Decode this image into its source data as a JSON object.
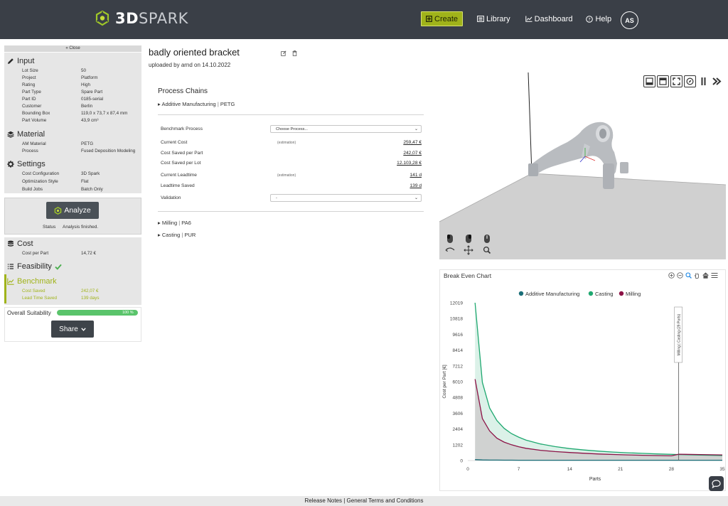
{
  "header": {
    "logo": {
      "brand_a": "3D",
      "brand_b": "SPARK"
    },
    "nav": {
      "create": "Create",
      "library": "Library",
      "dashboard": "Dashboard",
      "help": "Help"
    },
    "avatar": "AS"
  },
  "sidebar": {
    "close": "Close",
    "input": {
      "title": "Input",
      "rows": [
        {
          "label": "Lot Size",
          "value": "50"
        },
        {
          "label": "Project",
          "value": "Platform"
        },
        {
          "label": "Rating",
          "value": "High"
        },
        {
          "label": "Part Type",
          "value": "Spare Part"
        },
        {
          "label": "Part ID",
          "value": "0185-serial"
        },
        {
          "label": "Customer",
          "value": "Berlin"
        },
        {
          "label": "Bounding Box",
          "value": "119,0 x 73,7 x 87,4  mm"
        },
        {
          "label": "Part Volume",
          "value": "43,9 cm³"
        }
      ]
    },
    "material": {
      "title": "Material",
      "rows": [
        {
          "label": "AM Material",
          "value": "PETG"
        },
        {
          "label": "Process",
          "value": "Fused Deposition Modeling"
        }
      ]
    },
    "settings": {
      "title": "Settings",
      "rows": [
        {
          "label": "Cost Configuration",
          "value": "3D Spark"
        },
        {
          "label": "Optimization Style",
          "value": "Flat"
        },
        {
          "label": "Build Jobs",
          "value": "Batch Only"
        }
      ]
    },
    "analyze": {
      "button": "Analyze",
      "status_label": "Status",
      "status_value": "Analysis finished."
    },
    "cost": {
      "title": "Cost",
      "rows": [
        {
          "label": "Cost per Part",
          "value": "14,72 €"
        }
      ]
    },
    "feasibility": {
      "title": "Feasibility"
    },
    "benchmark": {
      "title": "Benchmark",
      "rows": [
        {
          "label": "Cost Saved",
          "value": "242,07 €"
        },
        {
          "label": "Lead Time Saved",
          "value": "139 days"
        }
      ]
    },
    "suitability": {
      "label": "Overall Suitability",
      "percent_text": "100 %",
      "value": 1.0
    },
    "share": "Share"
  },
  "main": {
    "title": "badly oriented bracket",
    "subtitle": "uploaded by arnd on 14.10.2022",
    "process_chains_title": "Process Chains",
    "chains": [
      {
        "name": "Additive Manufacturing",
        "material": "PETG"
      },
      {
        "name": "Milling",
        "material": "PA6"
      },
      {
        "name": "Casting",
        "material": "PUR"
      }
    ],
    "benchmark": {
      "process_label": "Benchmark Process",
      "process_select": "Choose Process...",
      "rows": [
        {
          "label": "Current Cost",
          "note": "(estimation)",
          "value": "259,47 €"
        },
        {
          "label": "Cost Saved per Part",
          "note": "",
          "value": "242,07 €"
        },
        {
          "label": "Cost Saved per Lot",
          "note": "",
          "value": "12.103,28 €"
        },
        {
          "label": "Current Leadtime",
          "note": "(estimation)",
          "value": "141 d"
        },
        {
          "label": "Leadtime Saved",
          "note": "",
          "value": "139 d"
        }
      ],
      "validation_label": "Validation",
      "validation_select": "-"
    }
  },
  "chart": {
    "title": "Break Even Chart"
  },
  "chart_data": {
    "type": "area",
    "title": "",
    "xlabel": "Parts",
    "ylabel": "Cost per Part [€]",
    "xlim": [
      0,
      35
    ],
    "ylim": [
      0,
      12019
    ],
    "x_ticks": [
      0,
      7,
      14,
      21,
      28,
      35
    ],
    "y_ticks": [
      0,
      1202,
      2404,
      3606,
      4808,
      6010,
      7212,
      8414,
      9616,
      10818,
      12019
    ],
    "legend_position": "top",
    "x": [
      1,
      2,
      3,
      4,
      5,
      6,
      7,
      8,
      10,
      12,
      14,
      16,
      18,
      20,
      22,
      24,
      26,
      28,
      29,
      30,
      32,
      35
    ],
    "series": [
      {
        "name": "Additive Manufacturing",
        "color": "#1a6e78",
        "values": [
          70,
          45,
          35,
          30,
          27,
          25,
          24,
          23,
          22,
          21,
          20,
          20,
          20,
          19,
          19,
          19,
          19,
          19,
          19,
          19,
          19,
          19
        ]
      },
      {
        "name": "Casting",
        "color": "#1fa870",
        "values": [
          12019,
          5950,
          4000,
          3050,
          2450,
          2050,
          1780,
          1560,
          1260,
          1060,
          910,
          800,
          715,
          645,
          590,
          545,
          505,
          470,
          455,
          440,
          415,
          380
        ]
      },
      {
        "name": "Milling",
        "color": "#8c1246",
        "values": [
          6200,
          3200,
          2250,
          1700,
          1400,
          1200,
          1050,
          930,
          780,
          680,
          610,
          550,
          500,
          460,
          430,
          400,
          380,
          360,
          480,
          470,
          455,
          430
        ]
      }
    ],
    "annotation": {
      "x": 29,
      "label": "Milling | Casting (29 Parts)"
    }
  }
}
